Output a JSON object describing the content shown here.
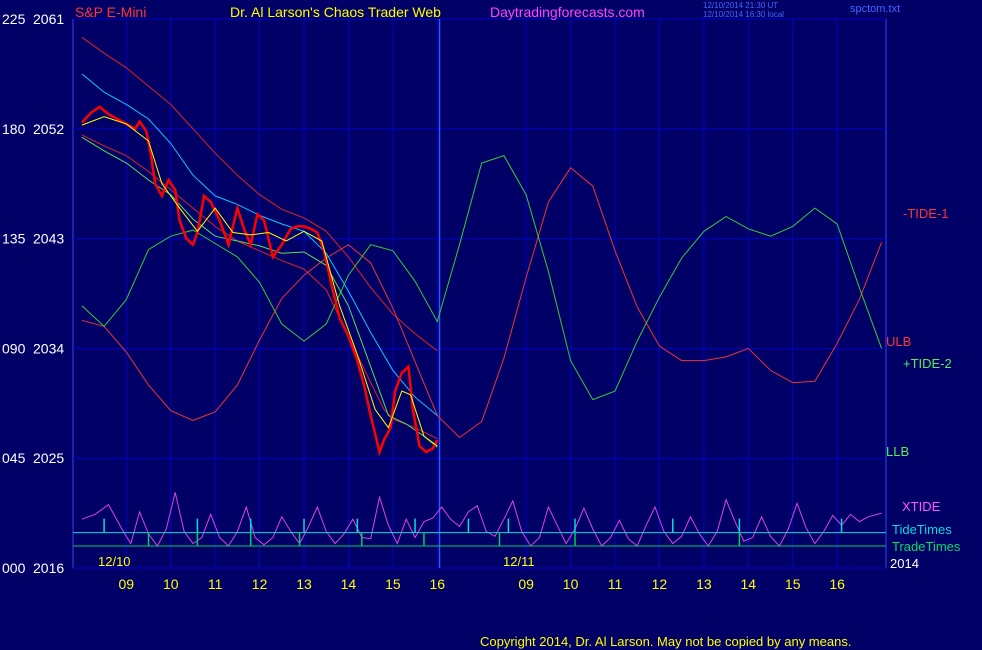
{
  "header": {
    "symbol": "S&P E-Mini",
    "title": "Dr. Al Larson's Chaos Trader Web",
    "site": "Daytradingforecasts.com",
    "time_line1": "12/10/2014 21:30 UT",
    "time_line2": "12/10/2014 16:30 local",
    "file": "spctom.txt"
  },
  "copyright": "Copyright 2014, Dr. Al Larson. May not be copied by any means.",
  "colors": {
    "background": "#000066",
    "grid": "#0000cc",
    "price": "#ff0000",
    "ulb_llb": "#dd2222",
    "tide1": "#ee3333",
    "tide2": "#33cc33",
    "xtide": "#dd44dd",
    "tidetimes": "#00dddd",
    "tradetimes": "#00cc66",
    "ma_fast": "#ffff00",
    "ma_slow": "#00ccff",
    "ma_green": "#55dd55"
  },
  "chart_data": {
    "type": "line",
    "y_left_labels": [
      "225",
      "180",
      "135",
      "090",
      "045",
      "000"
    ],
    "y_right_labels": [
      "2061",
      "2052",
      "2043",
      "2034",
      "2025",
      "2016"
    ],
    "ylim": [
      2016,
      2061
    ],
    "x_tick_labels": [
      "09",
      "10",
      "11",
      "12",
      "13",
      "14",
      "15",
      "16",
      "09",
      "10",
      "11",
      "12",
      "13",
      "14",
      "15",
      "16"
    ],
    "date_labels": [
      "12/10",
      "12/11",
      "2014"
    ],
    "series_labels": {
      "tide1": "-TIDE-1",
      "ulb": "ULB",
      "tide2": "+TIDE-2",
      "llb": "LLB",
      "xtide": "XTIDE",
      "tidetimes": "TideTimes",
      "tradetimes": "TradeTimes"
    },
    "price": [
      [
        8.0,
        2052.5
      ],
      [
        8.2,
        2053.3
      ],
      [
        8.4,
        2053.8
      ],
      [
        8.6,
        2053.2
      ],
      [
        8.8,
        2052.8
      ],
      [
        9.0,
        2052.4
      ],
      [
        9.2,
        2052.0
      ],
      [
        9.3,
        2052.6
      ],
      [
        9.45,
        2051.8
      ],
      [
        9.55,
        2050.0
      ],
      [
        9.65,
        2047.5
      ],
      [
        9.8,
        2046.5
      ],
      [
        9.95,
        2047.8
      ],
      [
        10.1,
        2047.0
      ],
      [
        10.2,
        2044.5
      ],
      [
        10.35,
        2043.0
      ],
      [
        10.5,
        2042.5
      ],
      [
        10.6,
        2043.5
      ],
      [
        10.75,
        2046.5
      ],
      [
        10.9,
        2046.0
      ],
      [
        11.1,
        2044.5
      ],
      [
        11.3,
        2042.5
      ],
      [
        11.5,
        2045.5
      ],
      [
        11.65,
        2043.8
      ],
      [
        11.8,
        2042.5
      ],
      [
        11.95,
        2045.0
      ],
      [
        12.1,
        2044.5
      ],
      [
        12.3,
        2041.5
      ],
      [
        12.5,
        2042.5
      ],
      [
        12.7,
        2043.8
      ],
      [
        12.85,
        2044.0
      ],
      [
        13.0,
        2044.0
      ],
      [
        13.15,
        2043.8
      ],
      [
        13.3,
        2043.5
      ],
      [
        13.45,
        2042.0
      ],
      [
        13.6,
        2039.5
      ],
      [
        13.8,
        2036.5
      ],
      [
        14.0,
        2035.0
      ],
      [
        14.2,
        2033.0
      ],
      [
        14.35,
        2031.0
      ],
      [
        14.5,
        2028.5
      ],
      [
        14.7,
        2025.5
      ],
      [
        14.8,
        2026.5
      ],
      [
        14.95,
        2027.5
      ],
      [
        15.05,
        2030.5
      ],
      [
        15.2,
        2032.0
      ],
      [
        15.35,
        2032.5
      ],
      [
        15.45,
        2029.0
      ],
      [
        15.6,
        2026.0
      ],
      [
        15.75,
        2025.5
      ],
      [
        15.9,
        2025.8
      ],
      [
        16.0,
        2026.5
      ]
    ],
    "ma_fast": [
      [
        8.0,
        2052.3
      ],
      [
        8.5,
        2053.0
      ],
      [
        9.0,
        2052.4
      ],
      [
        9.5,
        2051.0
      ],
      [
        9.8,
        2047.5
      ],
      [
        10.2,
        2045.5
      ],
      [
        10.6,
        2043.6
      ],
      [
        11.0,
        2045.5
      ],
      [
        11.4,
        2043.5
      ],
      [
        11.8,
        2043.3
      ],
      [
        12.2,
        2043.5
      ],
      [
        12.6,
        2042.8
      ],
      [
        13.0,
        2043.6
      ],
      [
        13.4,
        2042.8
      ],
      [
        13.8,
        2037.5
      ],
      [
        14.2,
        2033.5
      ],
      [
        14.6,
        2029.0
      ],
      [
        14.9,
        2027.5
      ],
      [
        15.2,
        2030.5
      ],
      [
        15.4,
        2030.2
      ],
      [
        15.7,
        2026.8
      ],
      [
        16.0,
        2026.0
      ]
    ],
    "ma_slow": [
      [
        8.0,
        2056.5
      ],
      [
        8.5,
        2055.0
      ],
      [
        9.0,
        2054.0
      ],
      [
        9.5,
        2052.8
      ],
      [
        10.0,
        2050.8
      ],
      [
        10.5,
        2048.2
      ],
      [
        11.0,
        2046.5
      ],
      [
        11.5,
        2045.8
      ],
      [
        12.0,
        2044.9
      ],
      [
        12.5,
        2044.2
      ],
      [
        13.0,
        2043.6
      ],
      [
        13.5,
        2041.8
      ],
      [
        14.0,
        2038.7
      ],
      [
        14.5,
        2035.3
      ],
      [
        15.0,
        2032.2
      ],
      [
        15.5,
        2030.0
      ],
      [
        16.0,
        2028.5
      ]
    ],
    "ma_green": [
      [
        8.0,
        2051.3
      ],
      [
        8.5,
        2050.2
      ],
      [
        9.0,
        2049.2
      ],
      [
        9.5,
        2047.8
      ],
      [
        10.0,
        2046.6
      ],
      [
        10.5,
        2044.6
      ],
      [
        11.0,
        2043.2
      ],
      [
        11.5,
        2042.8
      ],
      [
        12.0,
        2042.4
      ],
      [
        12.5,
        2041.8
      ],
      [
        13.0,
        2041.9
      ],
      [
        13.5,
        2040.8
      ],
      [
        14.0,
        2037.5
      ],
      [
        14.5,
        2032.5
      ],
      [
        14.9,
        2028.5
      ],
      [
        15.3,
        2027.8
      ],
      [
        15.7,
        2026.8
      ],
      [
        16.0,
        2025.9
      ]
    ],
    "ulb": [
      [
        8.0,
        2059.5
      ],
      [
        8.5,
        2058.2
      ],
      [
        9.0,
        2057.0
      ],
      [
        9.5,
        2055.5
      ],
      [
        10.0,
        2054.0
      ],
      [
        10.5,
        2052.0
      ],
      [
        11.0,
        2050.0
      ],
      [
        11.5,
        2048.2
      ],
      [
        12.0,
        2046.6
      ],
      [
        12.5,
        2045.4
      ],
      [
        13.0,
        2044.7
      ],
      [
        13.5,
        2043.6
      ],
      [
        14.0,
        2041.5
      ],
      [
        14.5,
        2039.0
      ],
      [
        15.0,
        2036.8
      ],
      [
        15.5,
        2035.2
      ],
      [
        16.0,
        2033.8
      ]
    ],
    "llb": [
      [
        8.0,
        2051.5
      ],
      [
        8.5,
        2050.6
      ],
      [
        9.0,
        2049.8
      ],
      [
        9.5,
        2048.5
      ],
      [
        10.0,
        2047.0
      ],
      [
        10.5,
        2045.5
      ],
      [
        11.0,
        2044.0
      ],
      [
        11.5,
        2042.8
      ],
      [
        12.0,
        2042.0
      ],
      [
        12.5,
        2041.2
      ],
      [
        13.0,
        2040.5
      ],
      [
        13.5,
        2038.8
      ],
      [
        14.0,
        2035.0
      ],
      [
        14.5,
        2031.2
      ],
      [
        14.8,
        2029.0
      ],
      [
        15.0,
        2028.2
      ],
      [
        15.5,
        2027.5
      ],
      [
        16.0,
        2026.6
      ]
    ],
    "tide1": [
      [
        8.0,
        2036.3
      ],
      [
        8.5,
        2035.8
      ],
      [
        9.0,
        2033.7
      ],
      [
        9.5,
        2031.0
      ],
      [
        10.0,
        2028.9
      ],
      [
        10.5,
        2028.1
      ],
      [
        11.0,
        2028.8
      ],
      [
        11.5,
        2031.0
      ],
      [
        12.0,
        2034.7
      ],
      [
        12.5,
        2038.1
      ],
      [
        13.0,
        2040.0
      ],
      [
        13.5,
        2041.4
      ],
      [
        14.0,
        2042.5
      ],
      [
        14.5,
        2041.0
      ],
      [
        15.0,
        2037.3
      ],
      [
        15.5,
        2032.9
      ],
      [
        16.0,
        2028.5
      ],
      [
        16.5,
        2026.7
      ],
      [
        17.0,
        2028.0
      ],
      [
        17.5,
        2033.2
      ],
      [
        18.0,
        2039.8
      ],
      [
        18.5,
        2046.0
      ],
      [
        19.0,
        2048.8
      ],
      [
        19.5,
        2047.3
      ],
      [
        20.0,
        2042.0
      ],
      [
        20.5,
        2037.4
      ],
      [
        21.0,
        2034.2
      ],
      [
        21.5,
        2033.0
      ],
      [
        22.0,
        2033.0
      ],
      [
        22.5,
        2033.3
      ],
      [
        23.0,
        2034.0
      ],
      [
        23.5,
        2032.2
      ],
      [
        24.0,
        2031.2
      ],
      [
        24.5,
        2031.3
      ],
      [
        25.0,
        2034.4
      ],
      [
        25.5,
        2038.0
      ],
      [
        26.0,
        2042.7
      ]
    ],
    "tide2": [
      [
        8.0,
        2037.5
      ],
      [
        8.5,
        2035.8
      ],
      [
        9.0,
        2038.0
      ],
      [
        9.5,
        2042.1
      ],
      [
        10.0,
        2043.2
      ],
      [
        10.5,
        2043.7
      ],
      [
        11.0,
        2042.6
      ],
      [
        11.5,
        2041.5
      ],
      [
        12.0,
        2039.4
      ],
      [
        12.5,
        2036.0
      ],
      [
        13.0,
        2034.6
      ],
      [
        13.5,
        2036.0
      ],
      [
        14.0,
        2040.0
      ],
      [
        14.5,
        2042.5
      ],
      [
        15.0,
        2042.0
      ],
      [
        15.5,
        2039.5
      ],
      [
        16.0,
        2036.2
      ],
      [
        16.5,
        2042.5
      ],
      [
        17.0,
        2049.2
      ],
      [
        17.5,
        2049.8
      ],
      [
        18.0,
        2046.6
      ],
      [
        18.5,
        2040.3
      ],
      [
        19.0,
        2033.0
      ],
      [
        19.5,
        2029.8
      ],
      [
        20.0,
        2030.5
      ],
      [
        20.5,
        2034.6
      ],
      [
        21.0,
        2038.2
      ],
      [
        21.5,
        2041.4
      ],
      [
        22.0,
        2043.6
      ],
      [
        22.5,
        2044.8
      ],
      [
        23.0,
        2043.8
      ],
      [
        23.5,
        2043.2
      ],
      [
        24.0,
        2044.0
      ],
      [
        24.5,
        2045.5
      ],
      [
        25.0,
        2044.2
      ],
      [
        25.5,
        2039.0
      ],
      [
        26.0,
        2034.0
      ]
    ],
    "xtide": [
      [
        8.0,
        2020.0
      ],
      [
        8.3,
        2020.4
      ],
      [
        8.6,
        2021.2
      ],
      [
        8.9,
        2019.2
      ],
      [
        9.1,
        2018.0
      ],
      [
        9.3,
        2020.6
      ],
      [
        9.5,
        2018.8
      ],
      [
        9.7,
        2017.8
      ],
      [
        9.9,
        2019.2
      ],
      [
        10.1,
        2022.2
      ],
      [
        10.3,
        2019.0
      ],
      [
        10.5,
        2018.0
      ],
      [
        10.7,
        2018.5
      ],
      [
        10.9,
        2020.4
      ],
      [
        11.1,
        2018.5
      ],
      [
        11.3,
        2017.8
      ],
      [
        11.5,
        2019.0
      ],
      [
        11.7,
        2021.0
      ],
      [
        11.9,
        2018.5
      ],
      [
        12.1,
        2017.9
      ],
      [
        12.3,
        2018.5
      ],
      [
        12.5,
        2020.2
      ],
      [
        12.7,
        2019.0
      ],
      [
        12.9,
        2018.0
      ],
      [
        13.1,
        2019.4
      ],
      [
        13.3,
        2021.0
      ],
      [
        13.5,
        2019.0
      ],
      [
        13.7,
        2018.0
      ],
      [
        13.9,
        2018.8
      ],
      [
        14.1,
        2020.0
      ],
      [
        14.3,
        2018.5
      ],
      [
        14.5,
        2018.4
      ],
      [
        14.7,
        2021.8
      ],
      [
        14.9,
        2019.5
      ],
      [
        15.1,
        2018.0
      ],
      [
        15.3,
        2020.0
      ],
      [
        15.5,
        2018.5
      ],
      [
        15.7,
        2019.8
      ],
      [
        15.9,
        2020.1
      ],
      [
        16.1,
        2021.0
      ],
      [
        16.3,
        2020.0
      ],
      [
        16.5,
        2019.4
      ],
      [
        16.7,
        2020.6
      ],
      [
        16.9,
        2021.1
      ],
      [
        17.1,
        2019.0
      ],
      [
        17.3,
        2018.6
      ],
      [
        17.5,
        2020.0
      ],
      [
        17.7,
        2021.5
      ],
      [
        17.9,
        2019.0
      ],
      [
        18.1,
        2017.8
      ],
      [
        18.3,
        2018.5
      ],
      [
        18.5,
        2021.0
      ],
      [
        18.7,
        2019.5
      ],
      [
        18.9,
        2018.0
      ],
      [
        19.1,
        2019.2
      ],
      [
        19.3,
        2020.9
      ],
      [
        19.5,
        2019.2
      ],
      [
        19.7,
        2017.8
      ],
      [
        19.9,
        2018.5
      ],
      [
        20.1,
        2019.9
      ],
      [
        20.3,
        2018.4
      ],
      [
        20.5,
        2017.8
      ],
      [
        20.7,
        2019.5
      ],
      [
        20.9,
        2021.0
      ],
      [
        21.1,
        2019.0
      ],
      [
        21.3,
        2018.0
      ],
      [
        21.5,
        2018.6
      ],
      [
        21.7,
        2020.2
      ],
      [
        21.9,
        2018.8
      ],
      [
        22.1,
        2017.8
      ],
      [
        22.3,
        2019.0
      ],
      [
        22.5,
        2021.6
      ],
      [
        22.7,
        2019.8
      ],
      [
        22.9,
        2018.2
      ],
      [
        23.1,
        2018.5
      ],
      [
        23.3,
        2020.2
      ],
      [
        23.5,
        2018.6
      ],
      [
        23.7,
        2017.8
      ],
      [
        23.9,
        2019.2
      ],
      [
        24.1,
        2021.3
      ],
      [
        24.3,
        2019.3
      ],
      [
        24.5,
        2018.0
      ],
      [
        24.7,
        2019.0
      ],
      [
        24.9,
        2020.3
      ],
      [
        25.1,
        2019.5
      ],
      [
        25.3,
        2020.4
      ],
      [
        25.5,
        2019.8
      ],
      [
        25.7,
        2020.2
      ],
      [
        26.0,
        2020.5
      ]
    ],
    "tidetimes_level": 2018.9,
    "tradetimes_level": 2017.8,
    "tidetimes_marks": [
      8.5,
      10.6,
      11.8,
      13.0,
      14.2,
      15.5,
      16.7,
      17.6,
      19.1,
      21.3,
      22.8,
      25.1
    ],
    "tradetimes_marks": [
      9.5,
      10.6,
      11.8,
      12.9,
      14.3,
      15.7,
      17.4,
      19.1,
      22.8
    ]
  }
}
